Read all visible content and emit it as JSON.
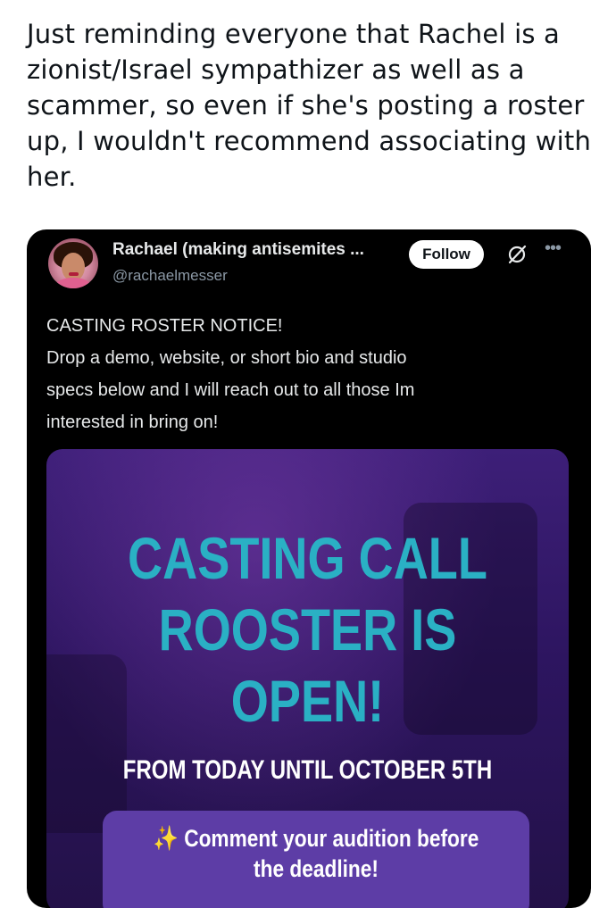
{
  "post": {
    "text": "Just reminding everyone that Rachel is a zionist/Israel sympathizer as well as a scammer, so even if she's posting a roster up, I wouldn't recommend associating with her."
  },
  "quoted_tweet": {
    "author_name": "Rachael (making antisemites ...",
    "author_handle": "@rachaelmesser",
    "follow_label": "Follow",
    "grok_icon": "grok-icon",
    "more_icon": "more-icon",
    "body_lines": [
      "CASTING ROSTER NOTICE!",
      "Drop a demo, website, or short bio and studio",
      "specs below and I will reach out to all those Im",
      "interested in bring on!"
    ],
    "media": {
      "headline_lines": [
        "CASTING CALL",
        "ROOSTER IS",
        "OPEN!"
      ],
      "dates": "FROM TODAY UNTIL OCTOBER 5TH",
      "cta_sparkle": "✨",
      "cta_line1": "Comment your audition before",
      "cta_line2": "the deadline!",
      "colors": {
        "headline": "#2ab0c4",
        "background": "#2d1560",
        "cta_box": "#5d3da6"
      }
    }
  }
}
